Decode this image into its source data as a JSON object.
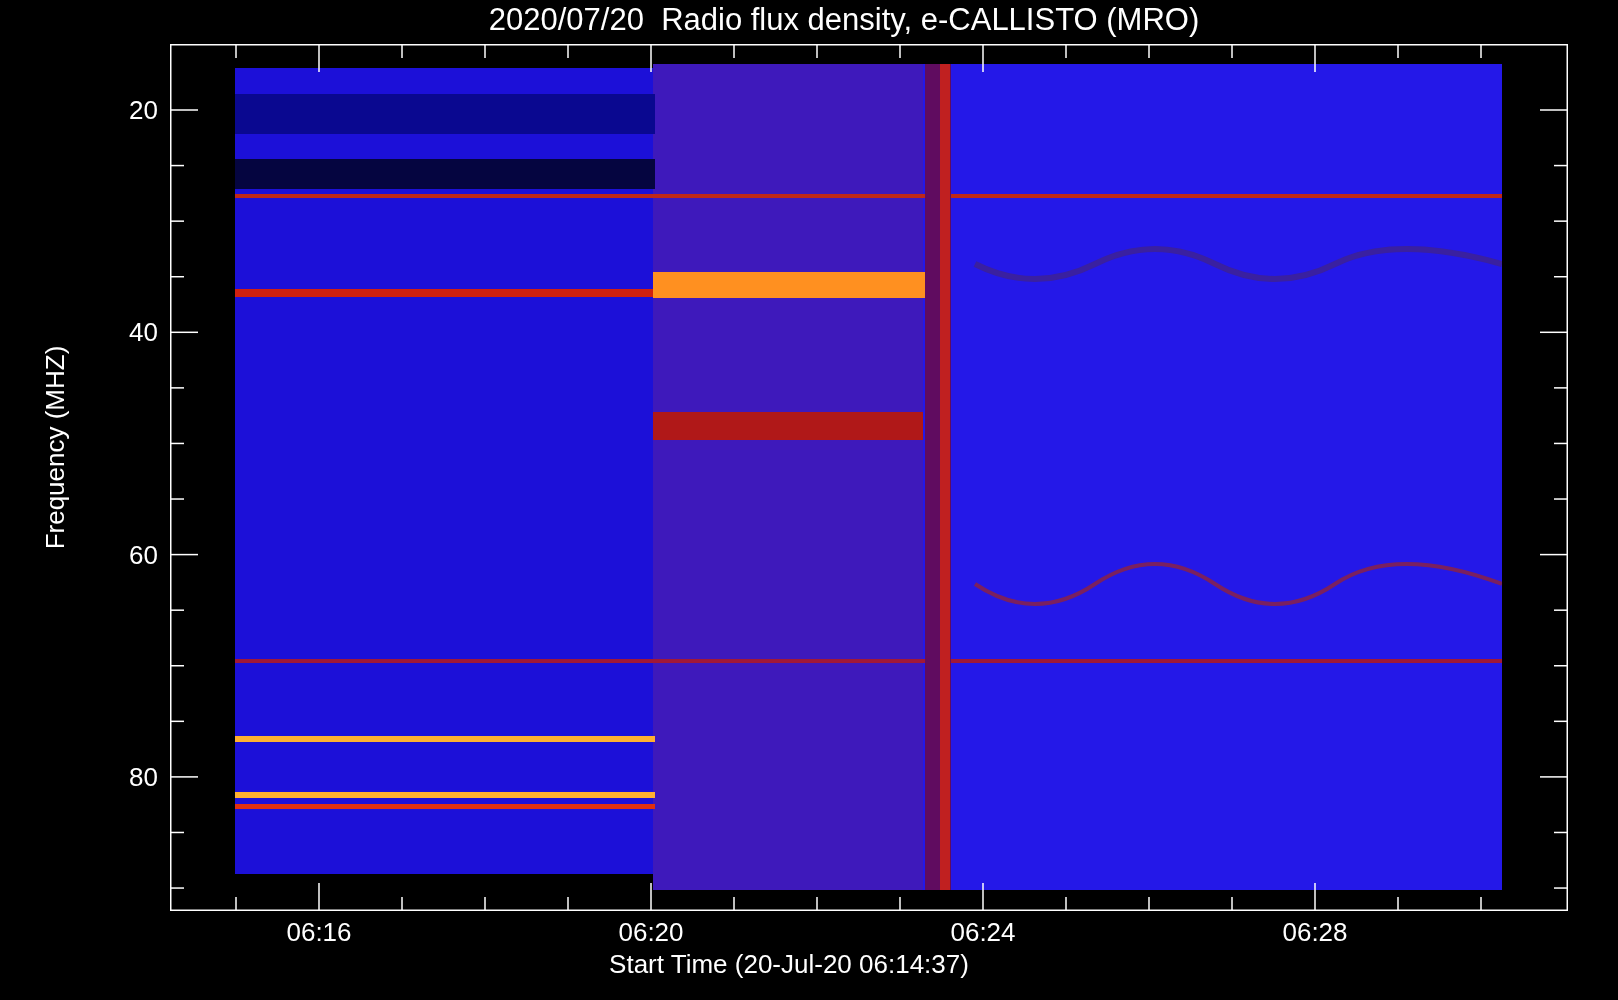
{
  "title": "2020/07/20  Radio flux density, e-CALLISTO (MRO)",
  "y_axis": {
    "label": "Frequency (MHZ)",
    "ticks": [
      "20",
      "40",
      "60",
      "80"
    ]
  },
  "x_axis": {
    "label": "Start Time (20-Jul-20 06:14:37)",
    "ticks": [
      "06:16",
      "06:20",
      "06:24",
      "06:28"
    ]
  }
}
